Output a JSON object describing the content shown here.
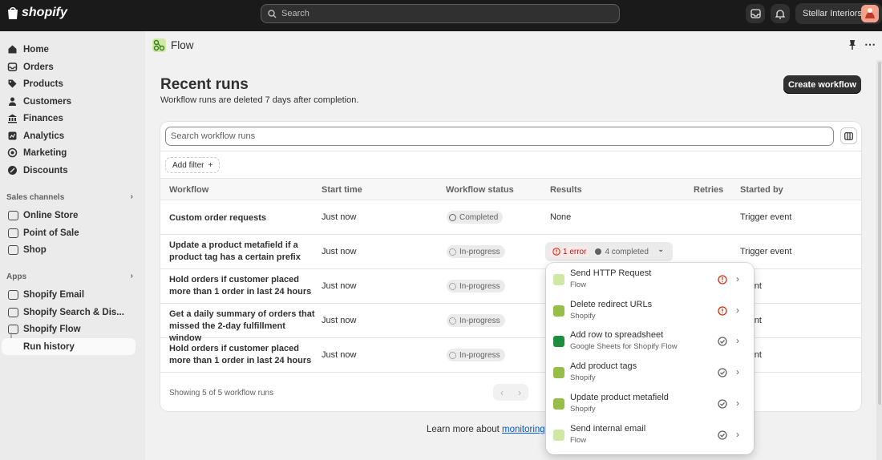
{
  "topbar": {
    "brand": "shopify",
    "search_placeholder": "Search",
    "store_name": "Stellar Interiors"
  },
  "sidebar": {
    "main_items": [
      {
        "label": "Home",
        "icon": "home-icon"
      },
      {
        "label": "Orders",
        "icon": "orders-icon"
      },
      {
        "label": "Products",
        "icon": "tag-icon"
      },
      {
        "label": "Customers",
        "icon": "person-icon"
      },
      {
        "label": "Finances",
        "icon": "bank-icon"
      },
      {
        "label": "Analytics",
        "icon": "chart-icon"
      },
      {
        "label": "Marketing",
        "icon": "target-icon"
      },
      {
        "label": "Discounts",
        "icon": "discount-icon"
      }
    ],
    "sales_channels_label": "Sales channels",
    "sales_channels": [
      {
        "label": "Online Store"
      },
      {
        "label": "Point of Sale"
      },
      {
        "label": "Shop"
      }
    ],
    "apps_label": "Apps",
    "apps": [
      {
        "label": "Shopify Email"
      },
      {
        "label": "Shopify Search & Dis..."
      },
      {
        "label": "Shopify Flow"
      }
    ],
    "sub_item": "Run history"
  },
  "app_header": {
    "title": "Flow"
  },
  "page": {
    "title": "Recent runs",
    "subtitle": "Workflow runs are deleted 7 days after completion.",
    "create_button": "Create workflow"
  },
  "table": {
    "search_placeholder": "Search workflow runs",
    "add_filter": "Add filter",
    "columns": [
      "Workflow",
      "Start time",
      "Workflow status",
      "Results",
      "Retries",
      "Started by"
    ],
    "rows": [
      {
        "workflow": "Custom order requests",
        "start": "Just now",
        "status": "Completed",
        "results": "None",
        "started_by": "Trigger event"
      },
      {
        "workflow": "Update a product metafield if a product tag has a certain prefix",
        "start": "Just now",
        "status": "In-progress",
        "results": "",
        "started_by": "Trigger event"
      },
      {
        "workflow": "Hold orders if customer placed more than 1 order in last 24 hours",
        "start": "Just now",
        "status": "In-progress",
        "results": "",
        "started_by": "event"
      },
      {
        "workflow": "Get a daily summary of orders that missed the 2-day fulfillment window",
        "start": "Just now",
        "status": "In-progress",
        "results": "",
        "started_by": "event"
      },
      {
        "workflow": "Hold orders if customer placed more than 1 order in last 24 hours",
        "start": "Just now",
        "status": "In-progress",
        "results": "",
        "started_by": "event"
      }
    ],
    "results_errors": "1 error",
    "results_completed": "4 completed",
    "footer": "Showing 5 of 5 workflow runs"
  },
  "learn_more": {
    "text": "Learn more about ",
    "link": "monitoring w"
  },
  "popup_items": [
    {
      "name": "Send HTTP Request",
      "source": "Flow",
      "status": "error",
      "icon": "flow-icon"
    },
    {
      "name": "Delete redirect URLs",
      "source": "Shopify",
      "status": "error",
      "icon": "shopify-bag-icon"
    },
    {
      "name": "Add row to spreadsheet",
      "source": "Google Sheets for Shopify Flow",
      "status": "completed",
      "icon": "google-sheets-icon"
    },
    {
      "name": "Add product tags",
      "source": "Shopify",
      "status": "completed",
      "icon": "shopify-bag-icon"
    },
    {
      "name": "Update product metafield",
      "source": "Shopify",
      "status": "completed",
      "icon": "shopify-bag-icon"
    },
    {
      "name": "Send internal email",
      "source": "Flow",
      "status": "completed",
      "icon": "flow-icon"
    }
  ],
  "colors": {
    "error": "#d72c0d",
    "accent": "#303030",
    "link": "#005bd3"
  }
}
